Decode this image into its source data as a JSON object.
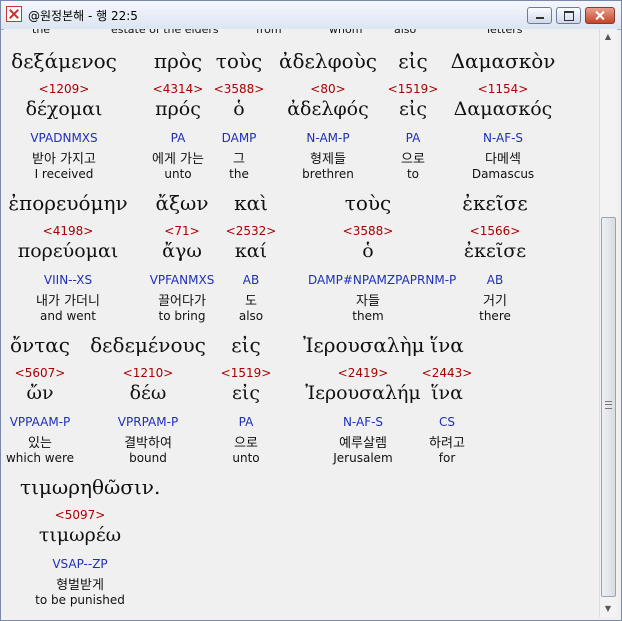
{
  "window": {
    "title": "@원정본해 - 행 22:5"
  },
  "cut_line": [
    "the",
    "estate of the elders",
    "from",
    "whom",
    "also",
    "letters"
  ],
  "rows": [
    {
      "words": [
        {
          "greek": "δεξάμενος",
          "num": "<1209>",
          "lemma": "δέχομαι",
          "morph": "VPADNMXS",
          "korean": "받아 가지고",
          "english": "I received"
        },
        {
          "greek": "πρὸς",
          "num": "<4314>",
          "lemma": "πρός",
          "morph": "PA",
          "korean": "에게 가는",
          "english": "unto"
        },
        {
          "greek": "τοὺς",
          "num": "<3588>",
          "lemma": "ὁ",
          "morph": "DAMP",
          "korean": "그",
          "english": "the"
        },
        {
          "greek": "ἀδελφοὺς",
          "num": "<80>",
          "lemma": "ἀδελφός",
          "morph": "N-AM-P",
          "korean": "형제들",
          "english": "brethren"
        },
        {
          "greek": "εἰς",
          "num": "<1519>",
          "lemma": "εἰς",
          "morph": "PA",
          "korean": "으로",
          "english": "to"
        },
        {
          "greek": "Δαμασκὸν",
          "num": "<1154>",
          "lemma": "Δαμασκός",
          "morph": "N-AF-S",
          "korean": "다메섹",
          "english": "Damascus"
        }
      ]
    },
    {
      "words": [
        {
          "greek": "ἐπορευόμην",
          "num": "<4198>",
          "lemma": "πορεύομαι",
          "morph": "VIIN--XS",
          "korean": "내가 가더니",
          "english": "and went"
        },
        {
          "greek": "ἄξων",
          "num": "<71>",
          "lemma": "ἄγω",
          "morph": "VPFANMXS",
          "korean": "끌어다가",
          "english": "to bring"
        },
        {
          "greek": "καὶ",
          "num": "<2532>",
          "lemma": "καί",
          "morph": "AB",
          "korean": "도",
          "english": "also"
        },
        {
          "greek": "τοὺς",
          "num": "<3588>",
          "lemma": "ὁ",
          "morph": "DAMP#NPAMZPAPRNM-P",
          "korean": "자들",
          "english": "them"
        },
        {
          "greek": "ἐκεῖσε",
          "num": "<1566>",
          "lemma": "ἐκεῖσε",
          "morph": "AB",
          "korean": "거기",
          "english": "there"
        }
      ]
    },
    {
      "words": [
        {
          "greek": "ὄντας",
          "num": "<5607>",
          "lemma": "ὤν",
          "morph": "VPPAAM-P",
          "korean": "있는",
          "english": "which were"
        },
        {
          "greek": "δεδεμένους",
          "num": "<1210>",
          "lemma": "δέω",
          "morph": "VPRPAM-P",
          "korean": "결박하여",
          "english": "bound"
        },
        {
          "greek": "εἰς",
          "num": "<1519>",
          "lemma": "εἰς",
          "morph": "PA",
          "korean": "으로",
          "english": "unto"
        },
        {
          "greek": "Ἰερουσαλὴμ",
          "num": "<2419>",
          "lemma": "Ἰερουσαλήμ",
          "morph": "N-AF-S",
          "korean": "예루살렘",
          "english": "Jerusalem"
        },
        {
          "greek": "ἵνα",
          "num": "<2443>",
          "lemma": "ἵνα",
          "morph": "CS",
          "korean": "하려고",
          "english": "for"
        }
      ]
    },
    {
      "words": [
        {
          "greek": "τιμωρηθῶσιν.",
          "num": "<5097>",
          "lemma": "τιμωρέω",
          "morph": "VSAP--ZP",
          "korean": "형벌받게",
          "english": "to be punished"
        }
      ]
    }
  ],
  "colors": {
    "strongs": "#aa0000",
    "morph": "#1f2fb8"
  }
}
